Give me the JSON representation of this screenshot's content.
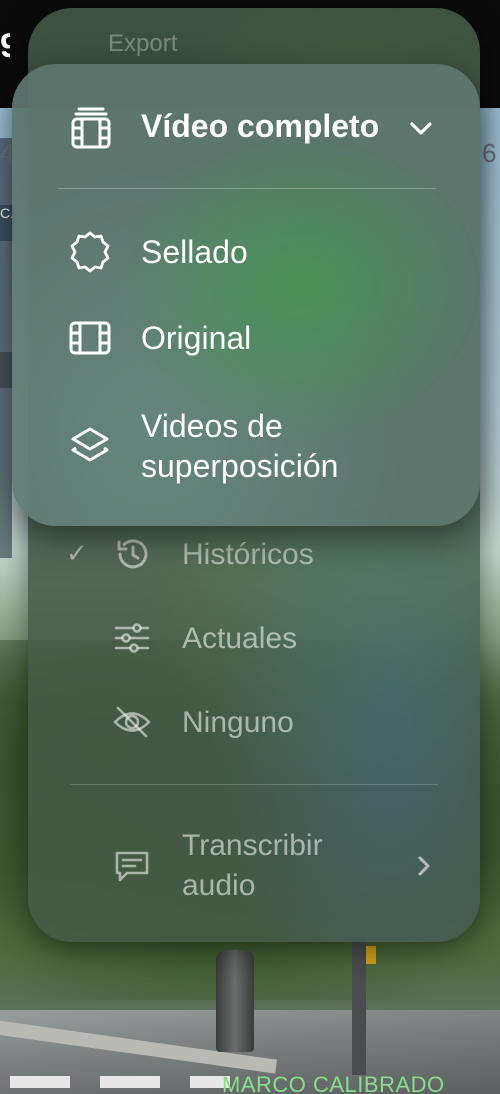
{
  "background": {
    "top_left_glyph": "9",
    "left_edge_number": "4",
    "right_edge_number": "6",
    "left_chip_text": "C.",
    "calibration_label": "MARCO CALIBRADO"
  },
  "back_menu": {
    "title": "Export",
    "items": [
      {
        "label": "Históricos",
        "icon": "history-clock-icon",
        "checked": true
      },
      {
        "label": "Actuales",
        "icon": "sliders-icon",
        "checked": false
      },
      {
        "label": "Ninguno",
        "icon": "eye-slash-icon",
        "checked": false
      }
    ],
    "check_mark": "✓",
    "transcribe": {
      "line1": "Transcribir",
      "line2": "audio",
      "icon": "caption-bubble-icon"
    }
  },
  "front_menu": {
    "header": {
      "label": "Vídeo completo",
      "icon": "film-stack-icon"
    },
    "items": [
      {
        "label": "Sellado",
        "icon": "seal-badge-icon"
      },
      {
        "label": "Original",
        "icon": "film-icon"
      },
      {
        "line1": "Videos de",
        "line2": "superposición",
        "icon": "layers-icon"
      }
    ]
  }
}
